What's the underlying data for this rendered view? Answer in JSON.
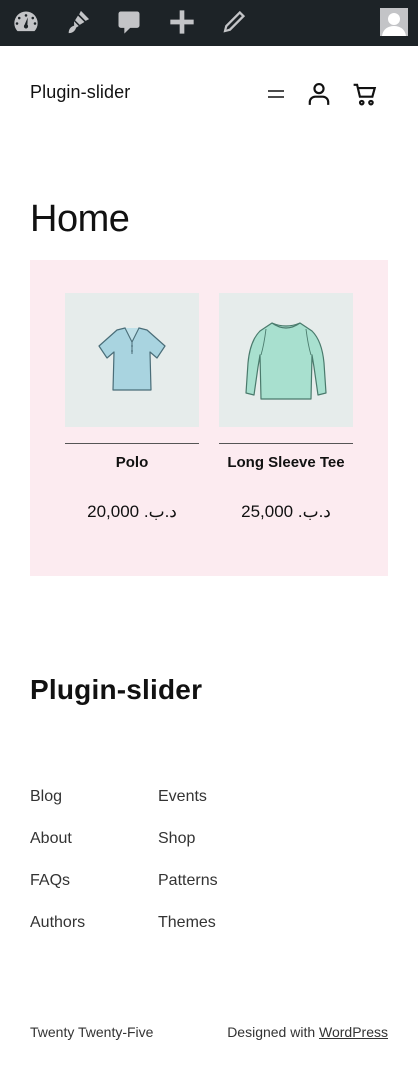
{
  "adminbar": {
    "icons": [
      "dashboard-icon",
      "customize-brush-icon",
      "comments-icon",
      "new-content-plus-icon",
      "edit-pencil-icon"
    ],
    "avatar": "user-avatar-icon"
  },
  "header": {
    "site_title": "Plugin-slider",
    "icons": [
      "menu-icon",
      "account-icon",
      "cart-icon"
    ]
  },
  "main": {
    "page_title": "Home",
    "products": [
      {
        "name": "Polo",
        "price": "د.ب. 20,000",
        "image": "polo-shirt-image"
      },
      {
        "name": "Long Sleeve Tee",
        "price": "د.ب. 25,000",
        "image": "long-sleeve-tee-image"
      }
    ],
    "block_background": "#fcebf0"
  },
  "footer": {
    "site_title": "Plugin-slider",
    "nav_col1": [
      "Blog",
      "About",
      "FAQs",
      "Authors"
    ],
    "nav_col2": [
      "Events",
      "Shop",
      "Patterns",
      "Themes"
    ],
    "credit_left": "Twenty Twenty-Five",
    "credit_prefix": "Designed with",
    "credit_link": "WordPress"
  }
}
